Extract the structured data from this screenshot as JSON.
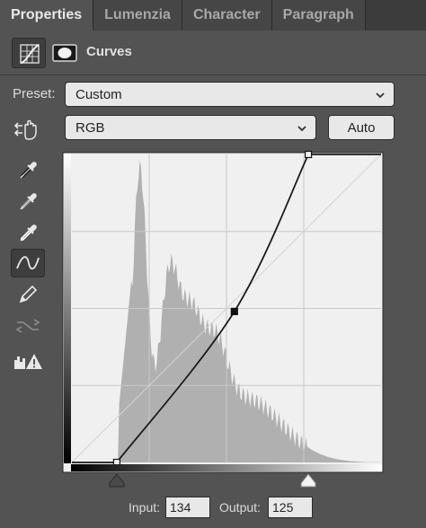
{
  "tabs": [
    {
      "label": "Properties",
      "active": true
    },
    {
      "label": "Lumenzia",
      "active": false
    },
    {
      "label": "Character",
      "active": false
    },
    {
      "label": "Paragraph",
      "active": false
    }
  ],
  "header": {
    "title": "Curves"
  },
  "preset": {
    "label": "Preset:",
    "value": "Custom"
  },
  "channel": {
    "value": "RGB"
  },
  "auto_button": "Auto",
  "input": {
    "label": "Input:",
    "value": "134"
  },
  "output": {
    "label": "Output:",
    "value": "125"
  },
  "curve": {
    "points": [
      [
        37,
        0
      ],
      [
        134,
        125
      ],
      [
        195,
        255
      ]
    ],
    "range": [
      0,
      255
    ]
  },
  "colors": {
    "panel_bg": "#535353",
    "graph_bg": "#f0f0f0",
    "histogram": "#b0b0b0",
    "curve": "#1a1a1a"
  },
  "icons": {
    "curves_adjustment": "curves-icon",
    "layer_mask": "mask-icon",
    "target_adjust": "hand-target-icon",
    "black_point": "eyedropper-black-icon",
    "gray_point": "eyedropper-gray-icon",
    "white_point": "eyedropper-white-icon",
    "edit_points": "curve-points-icon",
    "pencil": "pencil-icon",
    "smooth": "smooth-curve-icon",
    "clipping": "clipping-warning-icon"
  }
}
